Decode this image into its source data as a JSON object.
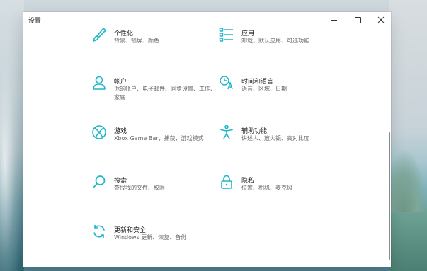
{
  "window": {
    "title": "设置"
  },
  "colors": {
    "accent": "#1fb7c7"
  },
  "tiles": [
    {
      "id": "personalization",
      "icon": "paintbrush-icon",
      "name": "个性化",
      "desc": "背景、锁屏、颜色"
    },
    {
      "id": "apps",
      "icon": "apps-list-icon",
      "name": "应用",
      "desc": "卸载、默认应用、可选功能"
    },
    {
      "id": "accounts",
      "icon": "person-icon",
      "name": "帐户",
      "desc": "你的帐户、电子邮件、同步设置、工作、家庭"
    },
    {
      "id": "time-language",
      "icon": "time-language-icon",
      "name": "时间和语言",
      "desc": "语音、区域、日期"
    },
    {
      "id": "gaming",
      "icon": "xbox-icon",
      "name": "游戏",
      "desc": "Xbox Game Bar，捕获，游戏模式"
    },
    {
      "id": "accessibility",
      "icon": "accessibility-icon",
      "name": "辅助功能",
      "desc": "讲述人、放大镜、高对比度"
    },
    {
      "id": "search",
      "icon": "search-icon",
      "name": "搜索",
      "desc": "查找我的文件、权限"
    },
    {
      "id": "privacy",
      "icon": "lock-icon",
      "name": "隐私",
      "desc": "位置、相机、麦克风"
    },
    {
      "id": "update-security",
      "icon": "sync-icon",
      "name": "更新和安全",
      "desc": "Windows 更新、恢复、备份"
    }
  ]
}
